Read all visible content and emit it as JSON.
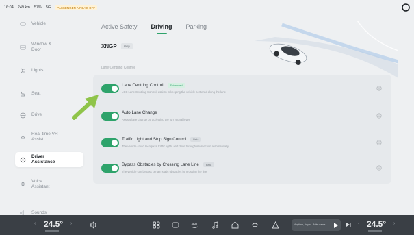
{
  "status": {
    "time": "16:04",
    "range": "249 km",
    "battery": "57%",
    "signal": "5G",
    "passenger_airbag": "PASSENGER AIRBAG OFF"
  },
  "sidebar": {
    "items": [
      {
        "label": "Vehicle",
        "icon": "car-icon"
      },
      {
        "label": "Window & Door",
        "icon": "window-icon"
      },
      {
        "label": "Lights",
        "icon": "lights-icon"
      },
      {
        "label": "Seat",
        "icon": "seat-icon"
      },
      {
        "label": "Drive",
        "icon": "steering-icon"
      },
      {
        "label": "Real-time VR Assist",
        "icon": "vr-icon"
      },
      {
        "label": "Driver Assistance",
        "icon": "assist-icon"
      },
      {
        "label": "Voice Assistant",
        "icon": "voice-icon"
      },
      {
        "label": "Sounds",
        "icon": "speaker-icon"
      }
    ],
    "active_index": 6
  },
  "tabs": [
    {
      "label": "Active Safety"
    },
    {
      "label": "Driving",
      "active": true
    },
    {
      "label": "Parking"
    }
  ],
  "xngp": {
    "title": "XNGP",
    "help": "Help"
  },
  "section_label": "Lane Centring Control",
  "features": [
    {
      "title": "Lane Centring Control",
      "badge": "Enhanced",
      "badge_type": "enhanced",
      "desc": "LCC Lane Centring Control, assists in keeping the vehicle centered along the lane",
      "enabled": true
    },
    {
      "title": "Auto Lane Change",
      "badge": "",
      "badge_type": "",
      "desc": "Assists lane change by activating the turn signal lever",
      "enabled": true
    },
    {
      "title": "Traffic Light and Stop Sign Control",
      "badge": "Beta",
      "badge_type": "beta",
      "desc": "The vehicle could recognize traffic lights and drive through intersection automatically",
      "enabled": true
    },
    {
      "title": "Bypass Obstacles by Crossing Lane Line",
      "badge": "Beta",
      "badge_type": "beta",
      "desc": "The vehicle can bypass certain static obstacles by crossing the line",
      "enabled": true
    }
  ],
  "bottom": {
    "temp_left": "24.5°",
    "temp_right": "24.5°",
    "media_text": "Anytime, Anyw... Artist name",
    "dock_icons": [
      "volume-icon",
      "apps-icon",
      "car-icon",
      "360-icon",
      "music-icon",
      "home-icon",
      "fan-icon",
      "navigation-icon"
    ]
  },
  "colors": {
    "accent": "#2ea36b",
    "arrow": "#8fc44a"
  }
}
